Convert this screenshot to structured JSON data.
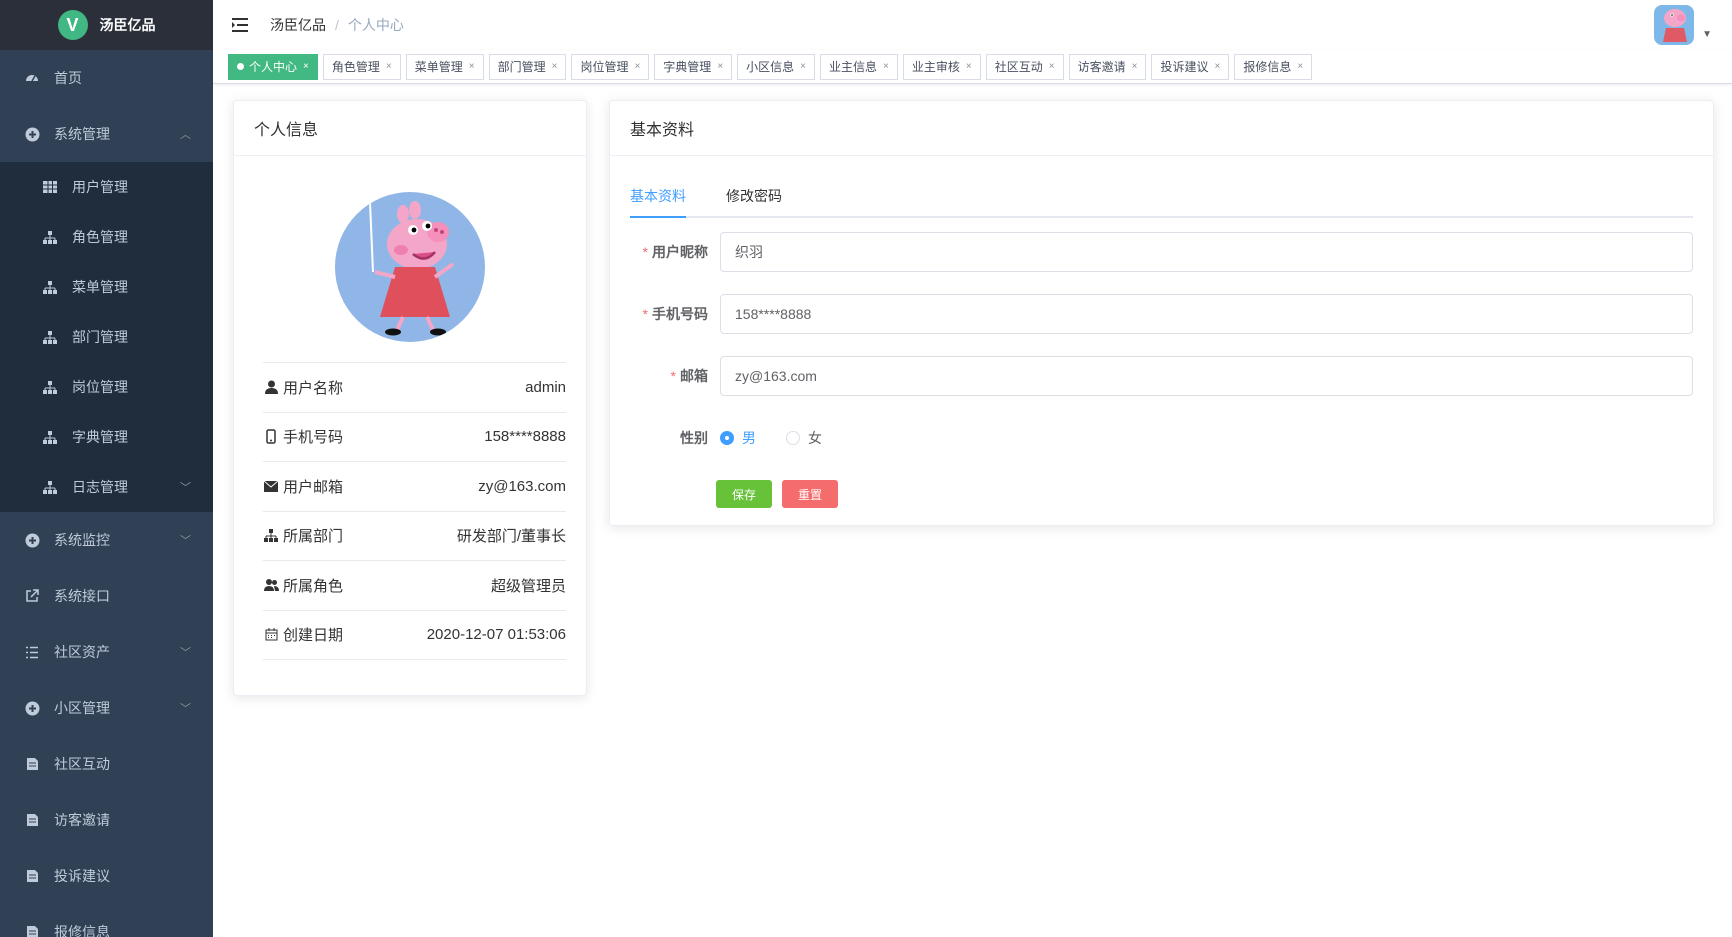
{
  "app": {
    "logo_letter": "V",
    "title": "汤臣亿品"
  },
  "sidebar": {
    "home": "首页",
    "system": "系统管理",
    "system_items": [
      {
        "label": "用户管理"
      },
      {
        "label": "角色管理"
      },
      {
        "label": "菜单管理"
      },
      {
        "label": "部门管理"
      },
      {
        "label": "岗位管理"
      },
      {
        "label": "字典管理"
      },
      {
        "label": "日志管理"
      }
    ],
    "monitor": "系统监控",
    "api": "系统接口",
    "assets": "社区资产",
    "estate": "小区管理",
    "interact": "社区互动",
    "visitor": "访客邀请",
    "complaint": "投诉建议",
    "repair": "报修信息"
  },
  "breadcrumb": {
    "root": "汤臣亿品",
    "current": "个人中心"
  },
  "tags": [
    {
      "label": "个人中心"
    },
    {
      "label": "角色管理"
    },
    {
      "label": "菜单管理"
    },
    {
      "label": "部门管理"
    },
    {
      "label": "岗位管理"
    },
    {
      "label": "字典管理"
    },
    {
      "label": "小区信息"
    },
    {
      "label": "业主信息"
    },
    {
      "label": "业主审核"
    },
    {
      "label": "社区互动"
    },
    {
      "label": "访客邀请"
    },
    {
      "label": "投诉建议"
    },
    {
      "label": "报修信息"
    }
  ],
  "profile_card": {
    "title": "个人信息",
    "rows": [
      {
        "label": "用户名称",
        "value": "admin"
      },
      {
        "label": "手机号码",
        "value": "158****8888"
      },
      {
        "label": "用户邮箱",
        "value": "zy@163.com"
      },
      {
        "label": "所属部门",
        "value": "研发部门/董事长"
      },
      {
        "label": "所属角色",
        "value": "超级管理员"
      },
      {
        "label": "创建日期",
        "value": "2020-12-07 01:53:06"
      }
    ]
  },
  "basic_card": {
    "title": "基本资料",
    "tabs": [
      "基本资料",
      "修改密码"
    ],
    "form": {
      "nickname_label": "用户昵称",
      "nickname_value": "织羽",
      "phone_label": "手机号码",
      "phone_value": "158****8888",
      "email_label": "邮箱",
      "email_value": "zy@163.com",
      "gender_label": "性别",
      "gender_male": "男",
      "gender_female": "女",
      "gender_selected": "男"
    },
    "save_label": "保存",
    "reset_label": "重置"
  },
  "colors": {
    "sidebar_bg": "#304156",
    "active_tag": "#42b983",
    "primary": "#409eff",
    "save": "#67c23a",
    "reset": "#f56c6c"
  }
}
